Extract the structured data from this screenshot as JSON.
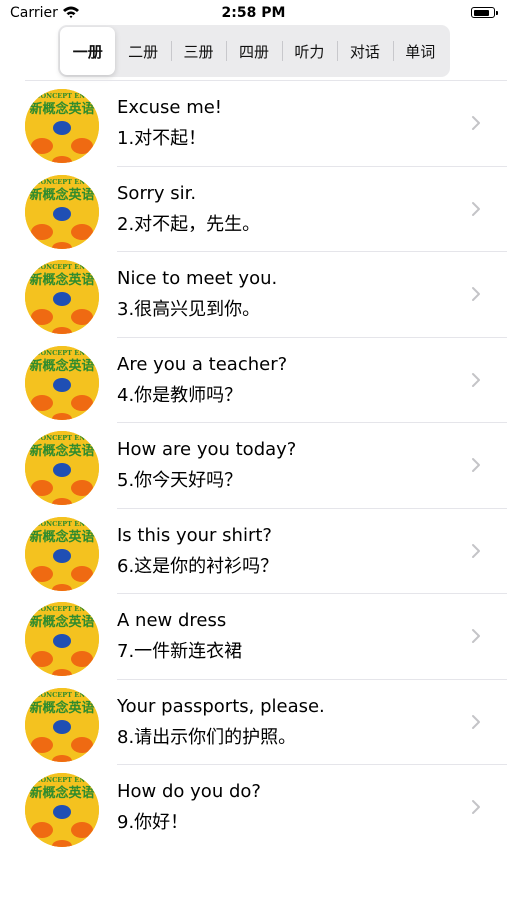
{
  "status": {
    "carrier": "Carrier",
    "time": "2:58 PM",
    "battery_level": 0.85
  },
  "tabs": [
    {
      "label": "一册",
      "selected": true
    },
    {
      "label": "二册",
      "selected": false
    },
    {
      "label": "三册",
      "selected": false
    },
    {
      "label": "四册",
      "selected": false
    },
    {
      "label": "听力",
      "selected": false
    },
    {
      "label": "对话",
      "selected": false
    },
    {
      "label": "单词",
      "selected": false
    }
  ],
  "thumbnail": {
    "banner": "W CONCEPT ENGLI",
    "logo": "新概念英语"
  },
  "lessons": [
    {
      "title": "Excuse me!",
      "subtitle": "1.对不起！"
    },
    {
      "title": "Sorry sir.",
      "subtitle": "2.对不起，先生。"
    },
    {
      "title": "Nice to meet you.",
      "subtitle": "3.很高兴见到你。"
    },
    {
      "title": "Are you a teacher?",
      "subtitle": "4.你是教师吗？"
    },
    {
      "title": "How are you today?",
      "subtitle": "5.你今天好吗？"
    },
    {
      "title": "Is this your shirt?",
      "subtitle": "6.这是你的衬衫吗？"
    },
    {
      "title": "A new dress",
      "subtitle": "7.一件新连衣裙"
    },
    {
      "title": "Your passports, please.",
      "subtitle": "8.请出示你们的护照。"
    },
    {
      "title": "How do you do?",
      "subtitle": "9.你好！"
    }
  ],
  "colors": {
    "chevron": "#c4c4c7",
    "separator": "#e5e5ea",
    "logo_green": "#2e8b2e",
    "logo_yellow": "#f4c21f",
    "logo_blue": "#1f4fb4",
    "logo_orange": "#ef6a12"
  }
}
